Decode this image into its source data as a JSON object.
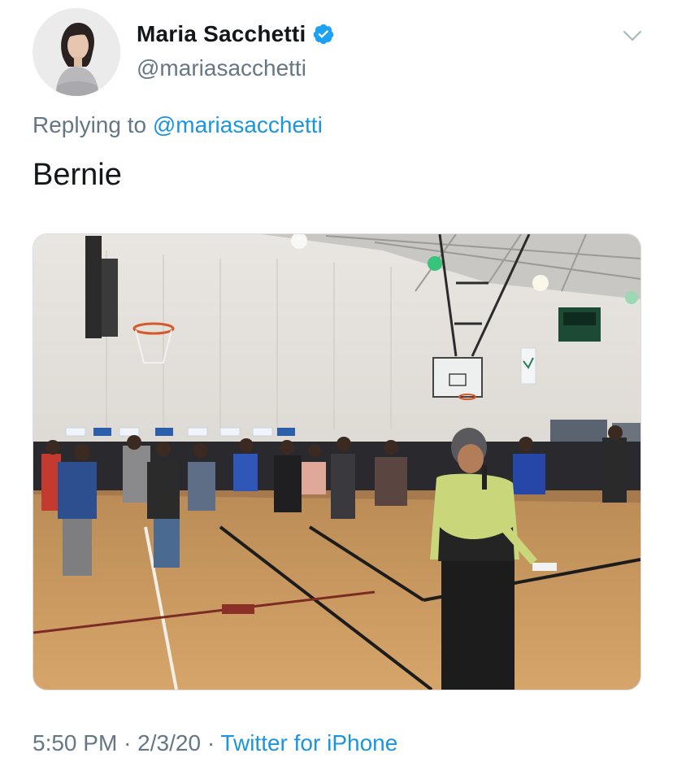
{
  "tweet": {
    "author": {
      "display_name": "Maria Sacchetti",
      "handle": "@mariasacchetti",
      "verified": true,
      "avatar_icon": "profile-photo"
    },
    "reply": {
      "prefix": "Replying to",
      "mention": "@mariasacchetti"
    },
    "text": "Bernie",
    "media": {
      "kind": "photo",
      "alt": "Crowd gathered in a gymnasium with a woman holding a microphone in the foreground"
    },
    "meta": {
      "time": "5:50 PM",
      "separator": "·",
      "date": "2/3/20",
      "source": "Twitter for iPhone"
    },
    "colors": {
      "link": "#1b95e0",
      "secondary_text": "#657786",
      "primary_text": "#14171a",
      "verified_badge": "#1da1f2"
    },
    "icons": {
      "verified": "verified-badge-icon",
      "menu": "chevron-down-icon"
    }
  }
}
